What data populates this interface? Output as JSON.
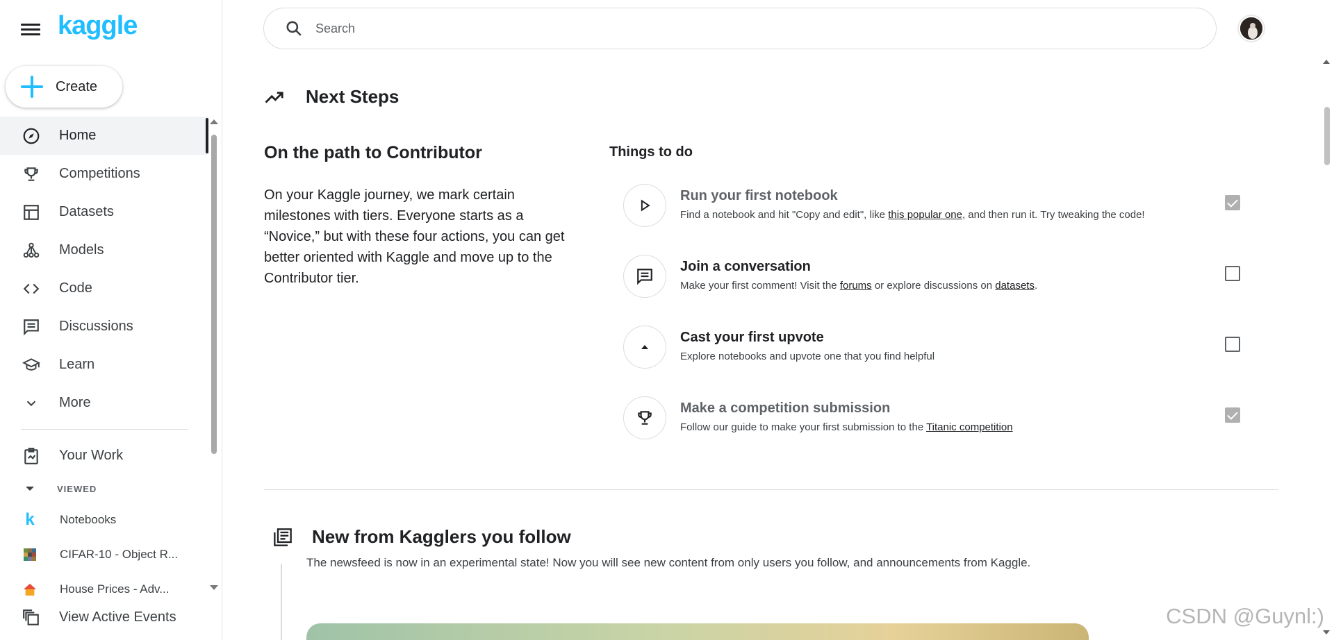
{
  "sidebar": {
    "logo": "kaggle",
    "create_label": "Create",
    "nav_items": [
      {
        "label": "Home",
        "icon": "compass-icon",
        "active": true
      },
      {
        "label": "Competitions",
        "icon": "trophy-icon"
      },
      {
        "label": "Datasets",
        "icon": "table-icon"
      },
      {
        "label": "Models",
        "icon": "models-icon"
      },
      {
        "label": "Code",
        "icon": "code-icon"
      },
      {
        "label": "Discussions",
        "icon": "comment-icon"
      },
      {
        "label": "Learn",
        "icon": "school-icon"
      },
      {
        "label": "More",
        "icon": "chevron-down-icon"
      }
    ],
    "your_work": "Your Work",
    "viewed_heading": "VIEWED",
    "viewed_items": [
      {
        "label": "Notebooks",
        "icon": "kaggle-k-icon"
      },
      {
        "label": "CIFAR-10 - Object R...",
        "icon": "cifar-thumbnail-icon"
      },
      {
        "label": "House Prices - Adv...",
        "icon": "house-thumbnail-icon"
      }
    ],
    "view_active_events": "View Active Events"
  },
  "search": {
    "placeholder": "Search"
  },
  "next_steps": {
    "title": "Next Steps",
    "path_title": "On the path to Contributor",
    "path_description": "On your Kaggle journey, we mark certain milestones with tiers. Everyone starts as a “Novice,” but with these four actions, you can get better oriented with Kaggle and move up to the Contributor tier.",
    "todo_heading": "Things to do",
    "todos": [
      {
        "title": "Run your first notebook",
        "desc_before": "Find a notebook and hit \"Copy and edit\", like ",
        "link1": "this popular one",
        "desc_middle": ", and then run it. Try tweaking the code!",
        "link2": "",
        "desc_after": "",
        "icon": "play-icon",
        "completed": true
      },
      {
        "title": "Join a conversation",
        "desc_before": "Make your first comment! Visit the ",
        "link1": "forums",
        "desc_middle": " or explore discussions on ",
        "link2": "datasets",
        "desc_after": ".",
        "icon": "comment-icon",
        "completed": false
      },
      {
        "title": "Cast your first upvote",
        "desc_before": "Explore notebooks and upvote one that you find helpful",
        "link1": "",
        "desc_middle": "",
        "link2": "",
        "desc_after": "",
        "icon": "upvote-icon",
        "completed": false
      },
      {
        "title": "Make a competition submission",
        "desc_before": "Follow our guide to make your first submission to the ",
        "link1": "Titanic competition",
        "desc_middle": "",
        "link2": "",
        "desc_after": "",
        "icon": "trophy-icon",
        "completed": true
      }
    ]
  },
  "newsfeed": {
    "title": "New from Kagglers you follow",
    "description": "The newsfeed is now in an experimental state! Now you will see new content from only users you follow, and announcements from Kaggle."
  },
  "watermark": "CSDN @Guynl:)",
  "colors": {
    "brand": "#20beff",
    "text": "#202124",
    "muted": "#5f6368",
    "border": "#dadce0"
  }
}
